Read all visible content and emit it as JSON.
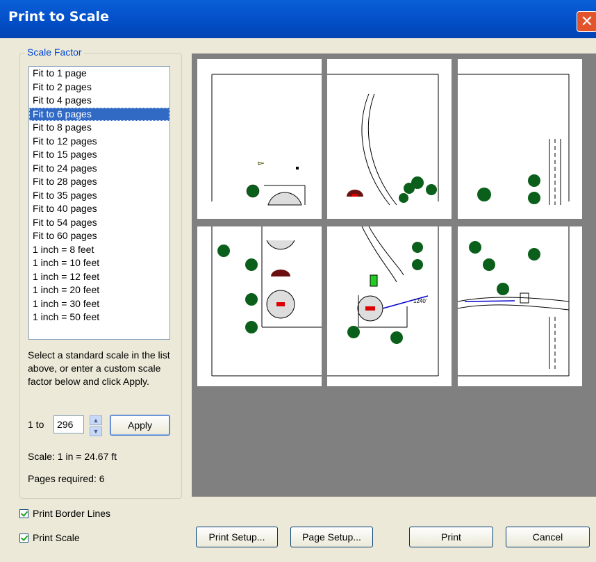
{
  "window": {
    "title": "Print to Scale",
    "close_glyph": "✕"
  },
  "scale_group": {
    "legend": "Scale Factor",
    "items": [
      "Fit to 1 page",
      "Fit to 2 pages",
      "Fit to 4 pages",
      "Fit to 6 pages",
      "Fit to 8 pages",
      "Fit to 12 pages",
      "Fit to 15 pages",
      "Fit to 24 pages",
      "Fit to 28 pages",
      "Fit to 35 pages",
      "Fit to 40 pages",
      "Fit to 54 pages",
      "Fit to 60 pages",
      "1 inch = 8 feet",
      "1 inch = 10 feet",
      "1 inch = 12 feet",
      "1 inch = 20 feet",
      "1 inch = 30 feet",
      "1 inch = 50 feet"
    ],
    "selected_index": 3,
    "help_text": "Select a standard scale in the list above, or enter a custom scale factor below and click Apply.",
    "to_label": "1 to",
    "custom_value": "296",
    "apply_label": "Apply",
    "scale_text": "Scale: 1 in = 24.67 ft",
    "pages_required": "Pages required: 6"
  },
  "preview": {
    "page_count": 6,
    "labels": {
      "distance": "1240'"
    }
  },
  "options": {
    "print_border_lines": {
      "label": "Print Border Lines",
      "checked": true
    },
    "print_scale": {
      "label": "Print Scale",
      "checked": true
    }
  },
  "buttons": {
    "print_setup": "Print Setup...",
    "page_setup": "Page Setup...",
    "print": "Print",
    "cancel": "Cancel"
  }
}
